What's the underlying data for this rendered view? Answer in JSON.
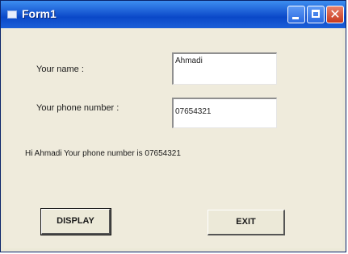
{
  "window": {
    "title": "Form1"
  },
  "form": {
    "name_label": "Your name :",
    "name_value": "Ahmadi",
    "phone_label": "Your phone number :",
    "phone_value": "07654321",
    "message": "Hi Ahmadi Your phone number is 07654321"
  },
  "buttons": {
    "display": "DISPLAY",
    "exit": "EXIT"
  },
  "colors": {
    "titlebar": "#1c5fd6",
    "form_background": "#efebdc",
    "close_button": "#c7391e"
  }
}
